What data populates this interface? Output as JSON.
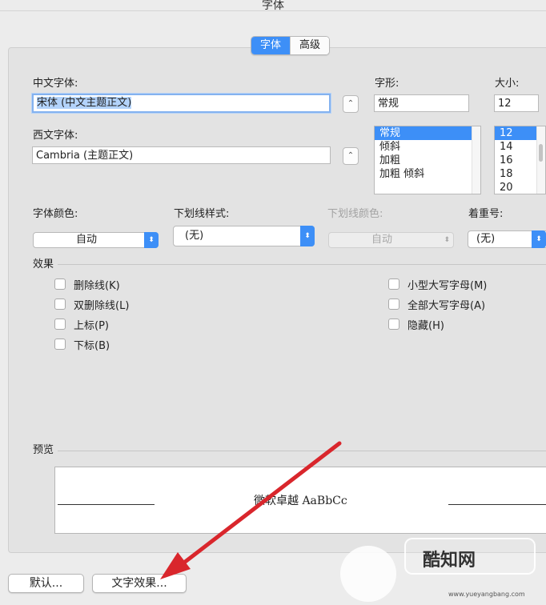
{
  "window": {
    "title": "字体"
  },
  "tabs": [
    {
      "label": "字体",
      "active": true
    },
    {
      "label": "高级",
      "active": false
    }
  ],
  "chinese_font": {
    "label": "中文字体:",
    "value": "宋体 (中文主题正文)"
  },
  "western_font": {
    "label": "西文字体:",
    "value": "Cambria (主题正文)"
  },
  "style": {
    "label": "字形:",
    "value": "常规",
    "options": [
      "常规",
      "倾斜",
      "加粗",
      "加粗 倾斜"
    ],
    "selected": "常规"
  },
  "size": {
    "label": "大小:",
    "value": "12",
    "options": [
      "12",
      "14",
      "16",
      "18",
      "20"
    ],
    "selected": "12"
  },
  "font_color": {
    "label": "字体颜色:",
    "value": "自动"
  },
  "underline_style": {
    "label": "下划线样式:",
    "value": "(无)"
  },
  "underline_color": {
    "label": "下划线颜色:",
    "value": "自动"
  },
  "emphasis": {
    "label": "着重号:",
    "value": "(无)"
  },
  "effects": {
    "label": "效果",
    "left": [
      {
        "label": "删除线(K)",
        "checked": false
      },
      {
        "label": "双删除线(L)",
        "checked": false
      },
      {
        "label": "上标(P)",
        "checked": false
      },
      {
        "label": "下标(B)",
        "checked": false
      }
    ],
    "right": [
      {
        "label": "小型大写字母(M)",
        "checked": false
      },
      {
        "label": "全部大写字母(A)",
        "checked": false
      },
      {
        "label": "隐藏(H)",
        "checked": false
      }
    ]
  },
  "preview": {
    "label": "预览",
    "sample": "微软卓越 AaBbCc"
  },
  "buttons": {
    "default": "默认...",
    "text_effects": "文字效果..."
  },
  "watermark": {
    "brand": "酷知网",
    "sub": "www.yueyangbang.com"
  },
  "colors": {
    "accent": "#3d8ff7",
    "annotation_arrow": "#d9262c"
  }
}
